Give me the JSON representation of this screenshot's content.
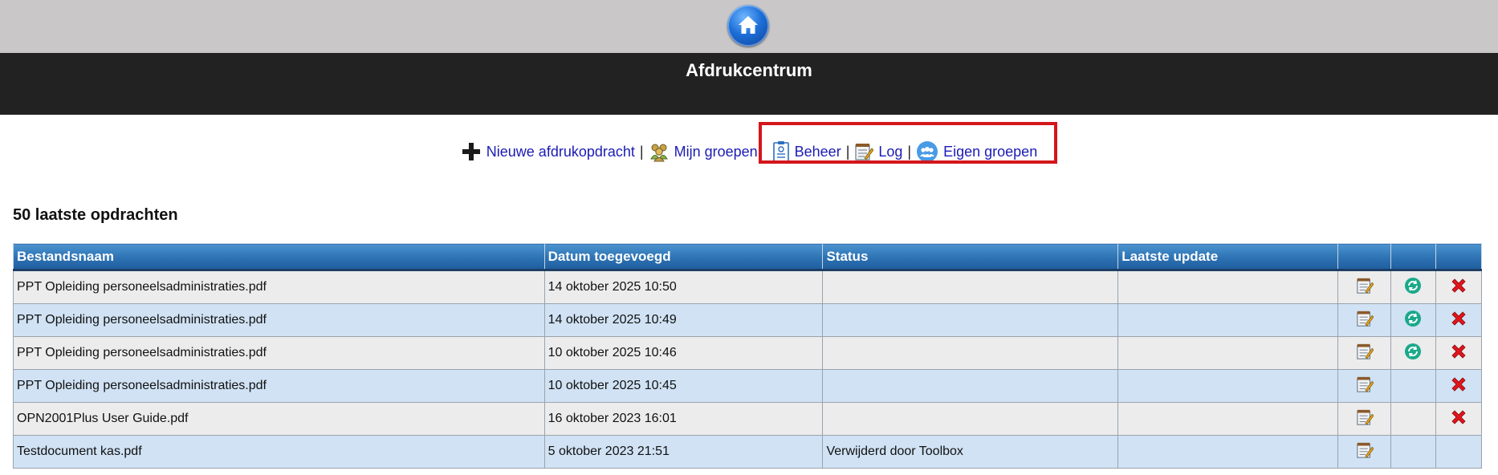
{
  "header": {
    "title": "Afdrukcentrum"
  },
  "nav": {
    "new_job": "Nieuwe afdrukopdracht",
    "my_groups": "Mijn groepen",
    "beheer": "Beheer",
    "log": "Log",
    "own_groups": "Eigen groepen",
    "separator": "|"
  },
  "section_title": "50 laatste opdrachten",
  "table": {
    "columns": [
      "Bestandsnaam",
      "Datum toegevoegd",
      "Status",
      "Laatste update",
      "",
      "",
      ""
    ],
    "rows": [
      {
        "file": "PPT Opleiding personeelsadministraties.pdf",
        "date": "14 oktober 2025 10:50",
        "status": "",
        "updated": "",
        "edit": true,
        "refresh": true,
        "delete": true
      },
      {
        "file": "PPT Opleiding personeelsadministraties.pdf",
        "date": "14 oktober 2025 10:49",
        "status": "",
        "updated": "",
        "edit": true,
        "refresh": true,
        "delete": true
      },
      {
        "file": "PPT Opleiding personeelsadministraties.pdf",
        "date": "10 oktober 2025 10:46",
        "status": "",
        "updated": "",
        "edit": true,
        "refresh": true,
        "delete": true
      },
      {
        "file": "PPT Opleiding personeelsadministraties.pdf",
        "date": "10 oktober 2025 10:45",
        "status": "",
        "updated": "",
        "edit": true,
        "refresh": false,
        "delete": true
      },
      {
        "file": "OPN2001Plus User Guide.pdf",
        "date": "16 oktober 2023 16:01",
        "status": "",
        "updated": "",
        "edit": true,
        "refresh": false,
        "delete": true
      },
      {
        "file": "Testdocument kas.pdf",
        "date": "5 oktober 2023 21:51",
        "status": "Verwijderd door Toolbox",
        "updated": "",
        "edit": true,
        "refresh": false,
        "delete": false
      }
    ]
  },
  "icons": {
    "home": "home-icon",
    "new_job": "plus-icon",
    "my_groups": "people-group-icon",
    "beheer": "clipboard-icon",
    "log": "log-notepad-icon",
    "own_groups": "own-groups-icon",
    "edit": "edit-notepad-icon",
    "refresh": "refresh-icon",
    "delete": "delete-x-icon"
  },
  "colors": {
    "link": "#1b1bb5",
    "header_bar": "#222222",
    "top_bar": "#c9c7c8",
    "table_header": "#2d72b3",
    "row_odd": "#ececec",
    "row_even": "#d0e2f4",
    "highlight": "#d4161b",
    "refresh": "#1aa98a",
    "delete": "#e0151c"
  }
}
